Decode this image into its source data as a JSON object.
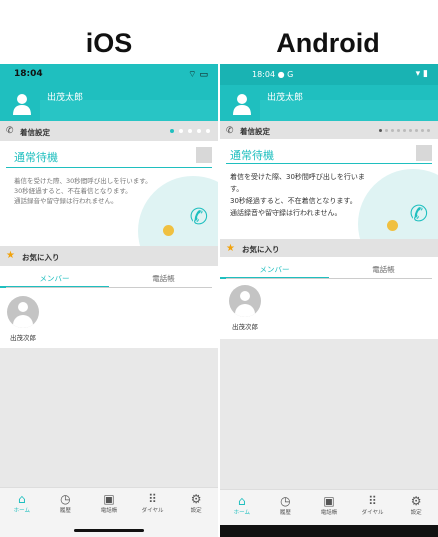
{
  "headings": {
    "ios": "iOS",
    "android": "Android"
  },
  "ios": {
    "time": "18:04",
    "status_icons": "⌔ ▭",
    "user_name": "出茂太郎",
    "incoming_label": "着信設定",
    "mode": "通常待機",
    "description": "着信を受けた際、30秒間呼び出しを行います。\n30秒経過すると、不在着信となります。\n通話録音や留守録は行われません。",
    "favorites_label": "お気に入り",
    "tabs": [
      "メンバー",
      "電話帳"
    ],
    "member_name": "出茂次郎",
    "nav": [
      "ホーム",
      "履歴",
      "電話帳",
      "ダイヤル",
      "設定"
    ]
  },
  "android": {
    "time": "18:04 ● G",
    "status_icons": "▾ ▮",
    "user_name": "出茂太郎",
    "incoming_label": "着信設定",
    "mode": "通常待機",
    "description": "着信を受けた際、30秒間呼び出しを行いま\nす。\n30秒経過すると、不在着信となります。\n通話録音や留守録は行われません。",
    "favorites_label": "お気に入り",
    "tabs": [
      "メンバー",
      "電話帳"
    ],
    "member_name": "出茂次郎",
    "nav": [
      "ホーム",
      "履歴",
      "電話帳",
      "ダイヤル",
      "設定"
    ]
  },
  "icons": {
    "nav": [
      "home-icon",
      "history-icon",
      "phonebook-icon",
      "dial-icon",
      "settings-icon"
    ],
    "phone": "phone-icon",
    "star": "star-icon"
  },
  "colors": {
    "accent": "#1fbfbf",
    "star": "#f1a20c"
  }
}
